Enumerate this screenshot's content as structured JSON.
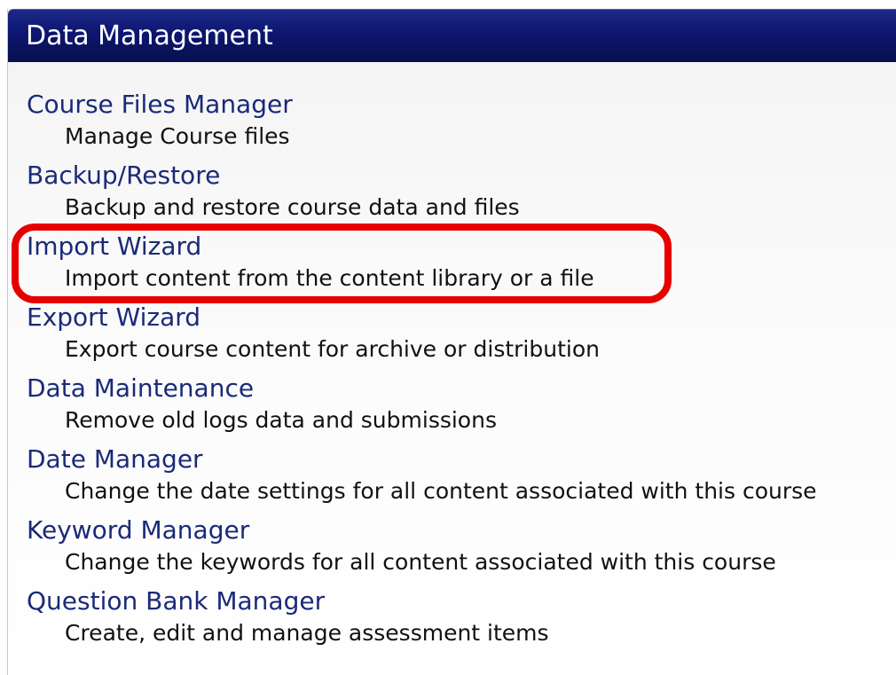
{
  "header": {
    "title": "Data Management"
  },
  "items": [
    {
      "label": "Course Files Manager",
      "description": "Manage Course files"
    },
    {
      "label": "Backup/Restore",
      "description": "Backup and restore course data and files"
    },
    {
      "label": "Import Wizard",
      "description": "Import content from the content library or a file"
    },
    {
      "label": "Export Wizard",
      "description": "Export course content for archive or distribution"
    },
    {
      "label": "Data Maintenance",
      "description": "Remove old logs data and submissions"
    },
    {
      "label": "Date Manager",
      "description": "Change the date settings for all content associated with this course"
    },
    {
      "label": "Keyword Manager",
      "description": "Change the keywords for all content associated with this course"
    },
    {
      "label": "Question Bank Manager",
      "description": "Create, edit and manage assessment items"
    }
  ],
  "colors": {
    "header_bg": "#0d1670",
    "link": "#1a2a78",
    "highlight": "#e60000"
  }
}
